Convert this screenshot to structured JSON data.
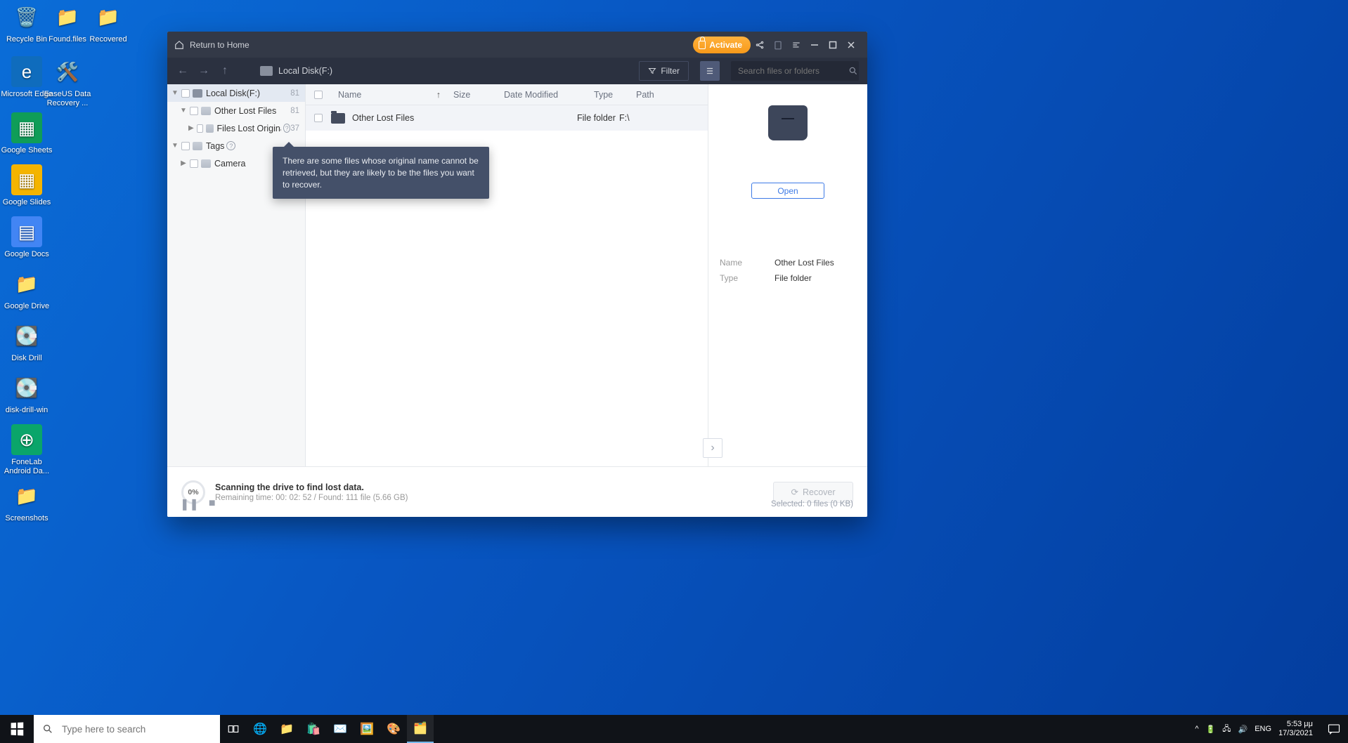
{
  "desktop_icons": [
    {
      "label": "Recycle Bin",
      "emoji": "🗑️"
    },
    {
      "label": "Found.files",
      "emoji": "📁"
    },
    {
      "label": "Recovered",
      "emoji": "📁"
    },
    {
      "label": "Microsoft Edge",
      "emoji": "🌐"
    },
    {
      "label": "EaseUS Data Recovery ...",
      "emoji": "🛠️"
    },
    {
      "label": "Google Sheets",
      "emoji": "📊"
    },
    {
      "label": "Google Slides",
      "emoji": "📽️"
    },
    {
      "label": "Google Docs",
      "emoji": "📄"
    },
    {
      "label": "Google Drive",
      "emoji": "📁"
    },
    {
      "label": "Disk Drill",
      "emoji": "💽"
    },
    {
      "label": "disk-drill-win",
      "emoji": "💽"
    },
    {
      "label": "FoneLab Android Da...",
      "emoji": "📱"
    },
    {
      "label": "Screenshots",
      "emoji": "📁"
    }
  ],
  "topbar": {
    "home": "Return to Home",
    "activate": "Activate"
  },
  "nav": {
    "crumb": "Local Disk(F:)",
    "filter": "Filter",
    "search_placeholder": "Search files or folders"
  },
  "tree": [
    {
      "label": "Local Disk(F:)",
      "count": "81",
      "indent": 0,
      "open": true,
      "sel": true,
      "help": false
    },
    {
      "label": "Other Lost Files",
      "count": "81",
      "indent": 1,
      "open": true,
      "sel": false,
      "help": false
    },
    {
      "label": "Files Lost Original N...",
      "count": "37",
      "indent": 2,
      "open": false,
      "sel": false,
      "help": true
    },
    {
      "label": "Tags",
      "count": "",
      "indent": 0,
      "open": true,
      "sel": false,
      "help": true
    },
    {
      "label": "Camera",
      "count": "",
      "indent": 1,
      "open": false,
      "sel": false,
      "help": false
    }
  ],
  "columns": {
    "name": "Name",
    "size": "Size",
    "date": "Date Modified",
    "type": "Type",
    "path": "Path"
  },
  "rows": [
    {
      "name": "Other Lost Files",
      "type": "File folder",
      "path": "F:\\"
    }
  ],
  "details": {
    "open": "Open",
    "name_k": "Name",
    "name_v": "Other Lost Files",
    "type_k": "Type",
    "type_v": "File folder"
  },
  "footer": {
    "pct": "0%",
    "title": "Scanning the drive to find lost data.",
    "sub": "Remaining time: 00: 02: 52 / Found: 111 file (5.66 GB)",
    "recover": "Recover",
    "selected": "Selected: 0 files (0 KB)"
  },
  "tooltip": "There are some files whose original name cannot be retrieved, but they are likely to be the files you want to recover.",
  "taskbar": {
    "search_placeholder": "Type here to search",
    "lang": "ENG",
    "time": "5:53 μμ",
    "date": "17/3/2021"
  }
}
